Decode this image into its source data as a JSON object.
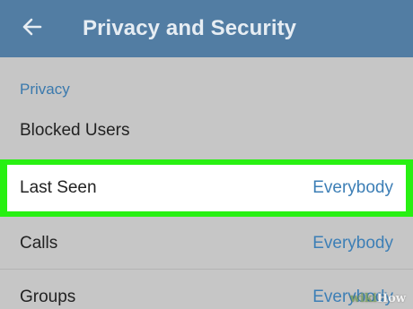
{
  "colors": {
    "header_bg": "#527da3",
    "accent": "#3a79ad",
    "highlight": "#28f012",
    "background": "#c6c6c6"
  },
  "header": {
    "back_icon": "arrow-left-icon",
    "title": "Privacy and Security"
  },
  "section": {
    "title": "Privacy"
  },
  "rows": [
    {
      "label": "Blocked Users",
      "value": ""
    },
    {
      "label": "Last Seen",
      "value": "Everybody",
      "highlighted": true
    },
    {
      "label": "Calls",
      "value": "Everybody"
    },
    {
      "label": "Groups",
      "value": "Everybody"
    }
  ],
  "watermark": {
    "prefix": "wiki",
    "suffix": "How"
  }
}
